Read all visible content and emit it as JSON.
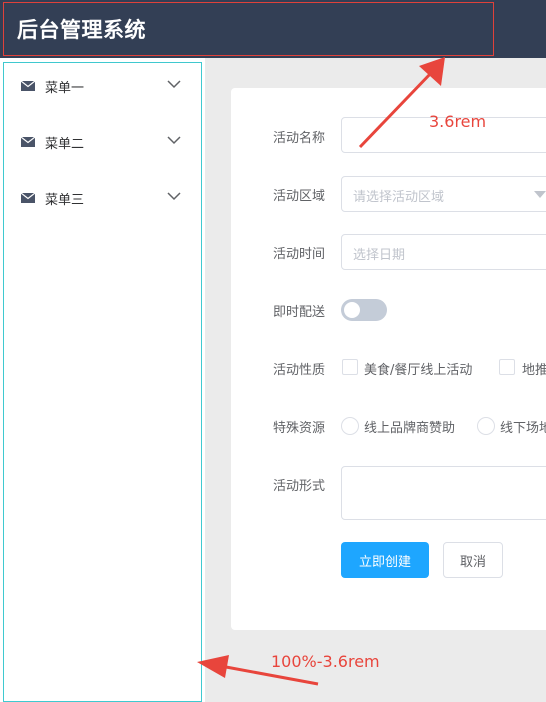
{
  "header": {
    "title": "后台管理系统"
  },
  "sidebar": {
    "items": [
      {
        "label": "菜单一"
      },
      {
        "label": "菜单二"
      },
      {
        "label": "菜单三"
      }
    ]
  },
  "form": {
    "name": {
      "label": "活动名称",
      "value": ""
    },
    "region": {
      "label": "活动区域",
      "placeholder": "请选择活动区域"
    },
    "time": {
      "label": "活动时间",
      "placeholder": "选择日期"
    },
    "delivery": {
      "label": "即时配送",
      "on": false
    },
    "type": {
      "label": "活动性质",
      "options": [
        "美食/餐厅线上活动",
        "地推"
      ]
    },
    "resource": {
      "label": "特殊资源",
      "options": [
        "线上品牌商赞助",
        "线下场地"
      ]
    },
    "desc": {
      "label": "活动形式",
      "value": ""
    },
    "submit_label": "立即创建",
    "cancel_label": "取消"
  },
  "annotations": {
    "header_height": "3.6rem",
    "sidebar_height": "100%-3.6rem"
  },
  "colors": {
    "header_bg": "#333f55",
    "primary": "#1ea6ff",
    "annotation": "#e8453c",
    "sidebar_outline": "#3fc9d0"
  }
}
